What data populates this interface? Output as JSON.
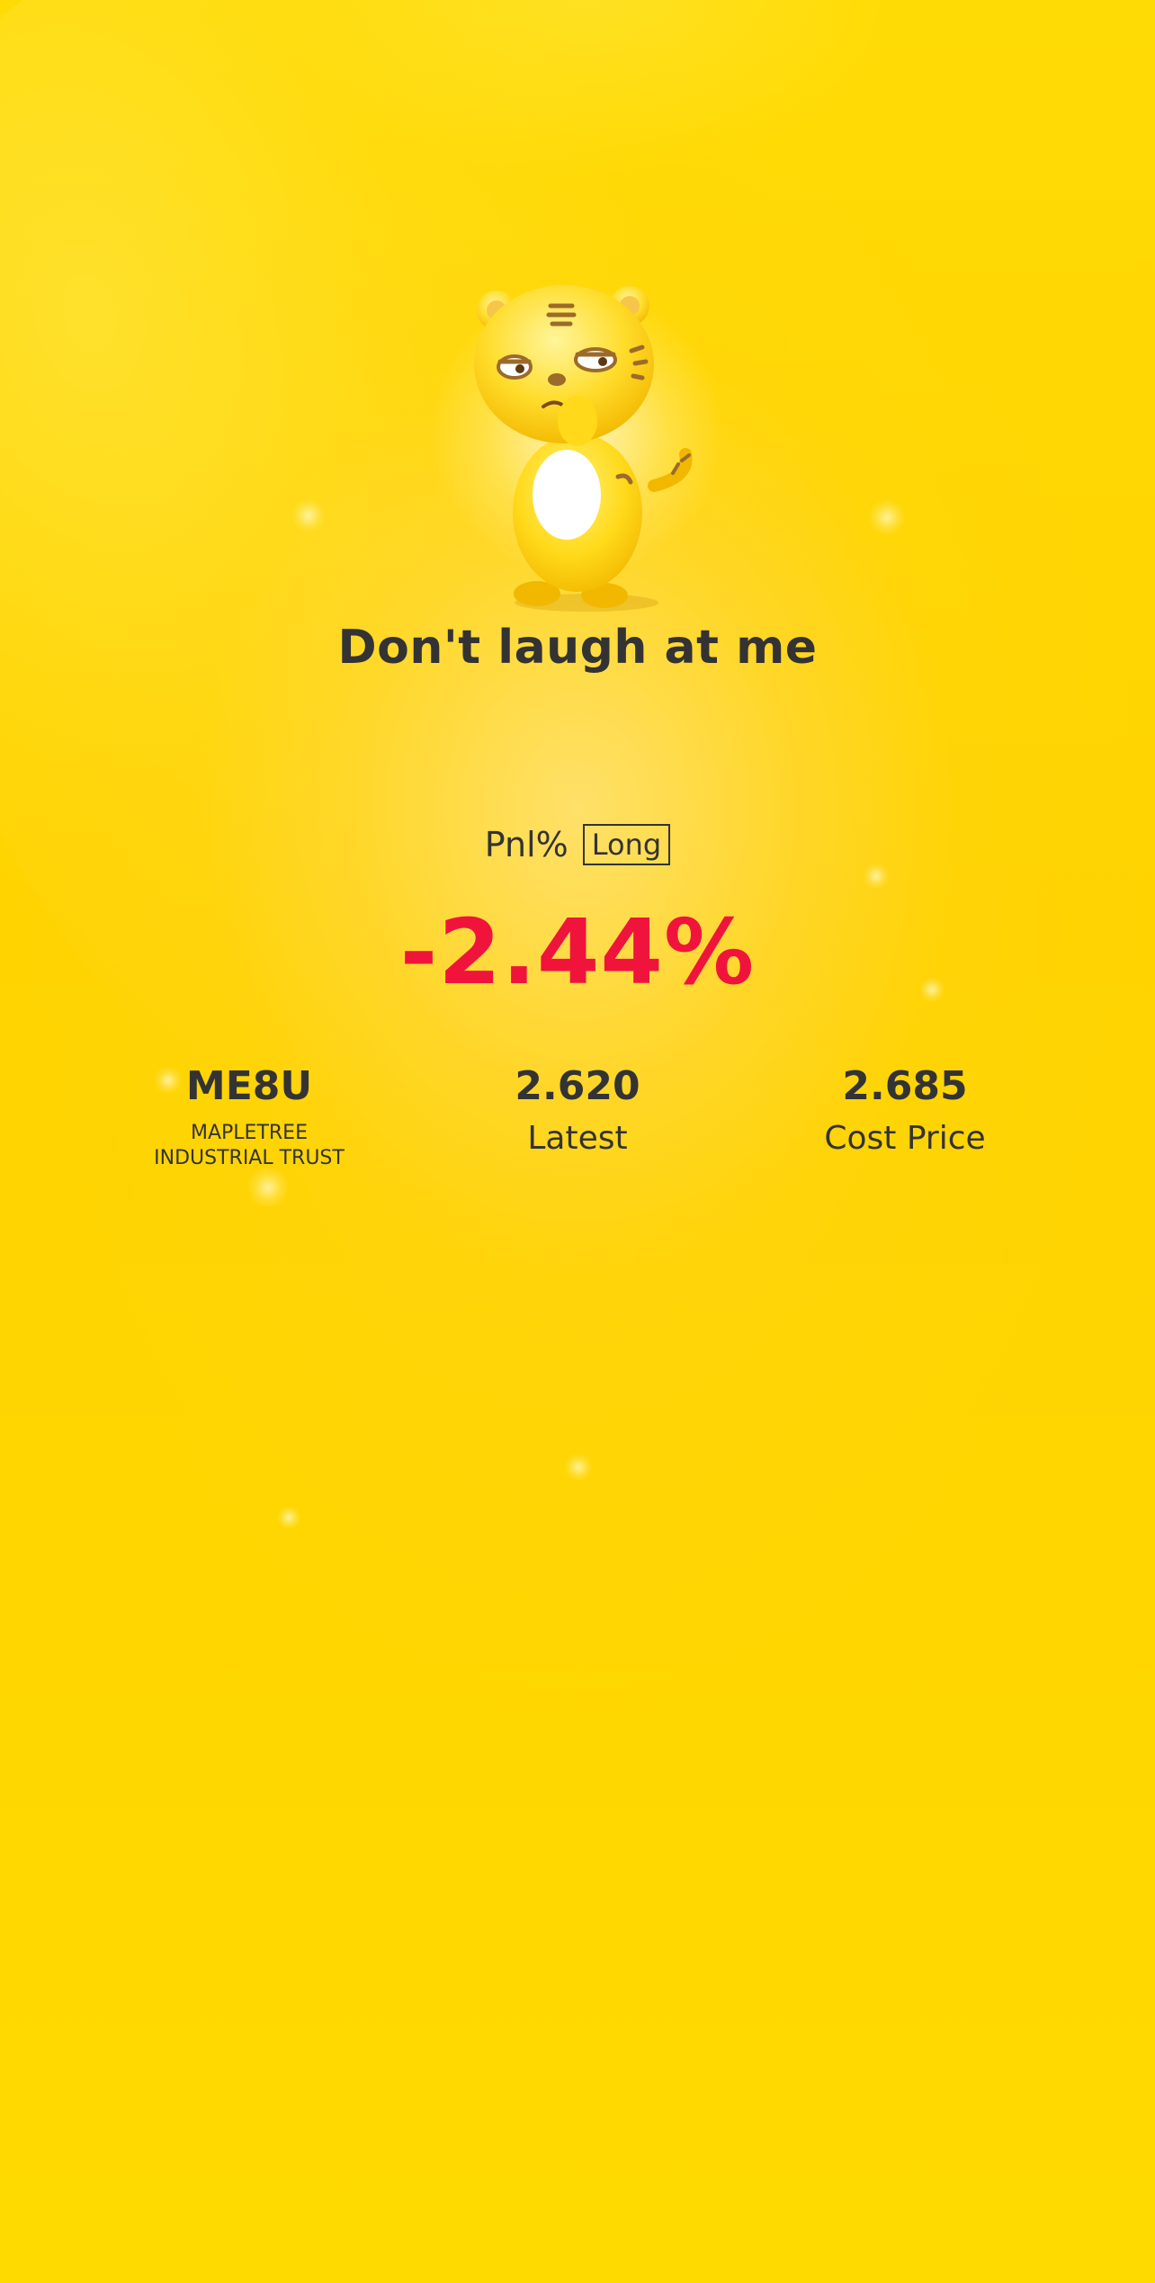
{
  "headline": "Don't laugh at me",
  "pnl": {
    "label": "Pnl%",
    "position_badge": "Long",
    "value": "-2.44%",
    "value_color": "#f0143c"
  },
  "stock": {
    "symbol": "ME8U",
    "name_line1": "MAPLETREE",
    "name_line2": "INDUSTRIAL TRUST"
  },
  "latest": {
    "value": "2.620",
    "label": "Latest"
  },
  "cost": {
    "value": "2.685",
    "label": "Cost Price"
  },
  "mascot": {
    "icon": "tiger-mascot-icon",
    "body_color": "#ffd91a",
    "stripe_color": "#9c6a2a"
  },
  "background_color": "#ffd800"
}
